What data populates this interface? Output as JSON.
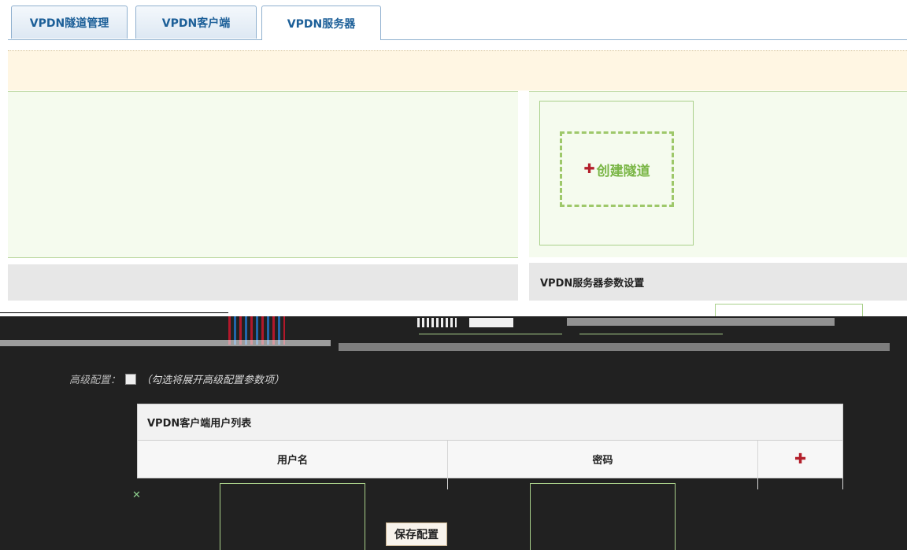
{
  "tabs": [
    {
      "label": "VPDN隧道管理",
      "active": false
    },
    {
      "label": "VPDN客户端",
      "active": false
    },
    {
      "label": "VPDN服务器",
      "active": true
    }
  ],
  "create_tunnel": {
    "label": "创建隧道"
  },
  "server_params": {
    "title": "VPDN服务器参数设置"
  },
  "advanced": {
    "label": "高级配置：",
    "hint": "（勾选将展开高级配置参数项）"
  },
  "user_table": {
    "title": "VPDN客户端用户列表",
    "columns": [
      "用户名",
      "密码"
    ],
    "add_symbol": "✚"
  },
  "actions": {
    "save": "保存配置"
  },
  "colors": {
    "tab_text": "#1c5f98",
    "accent_green": "#7ab646",
    "add_red": "#b3202c"
  },
  "icons": {
    "plus": "plus-icon",
    "delete": "delete-icon"
  }
}
